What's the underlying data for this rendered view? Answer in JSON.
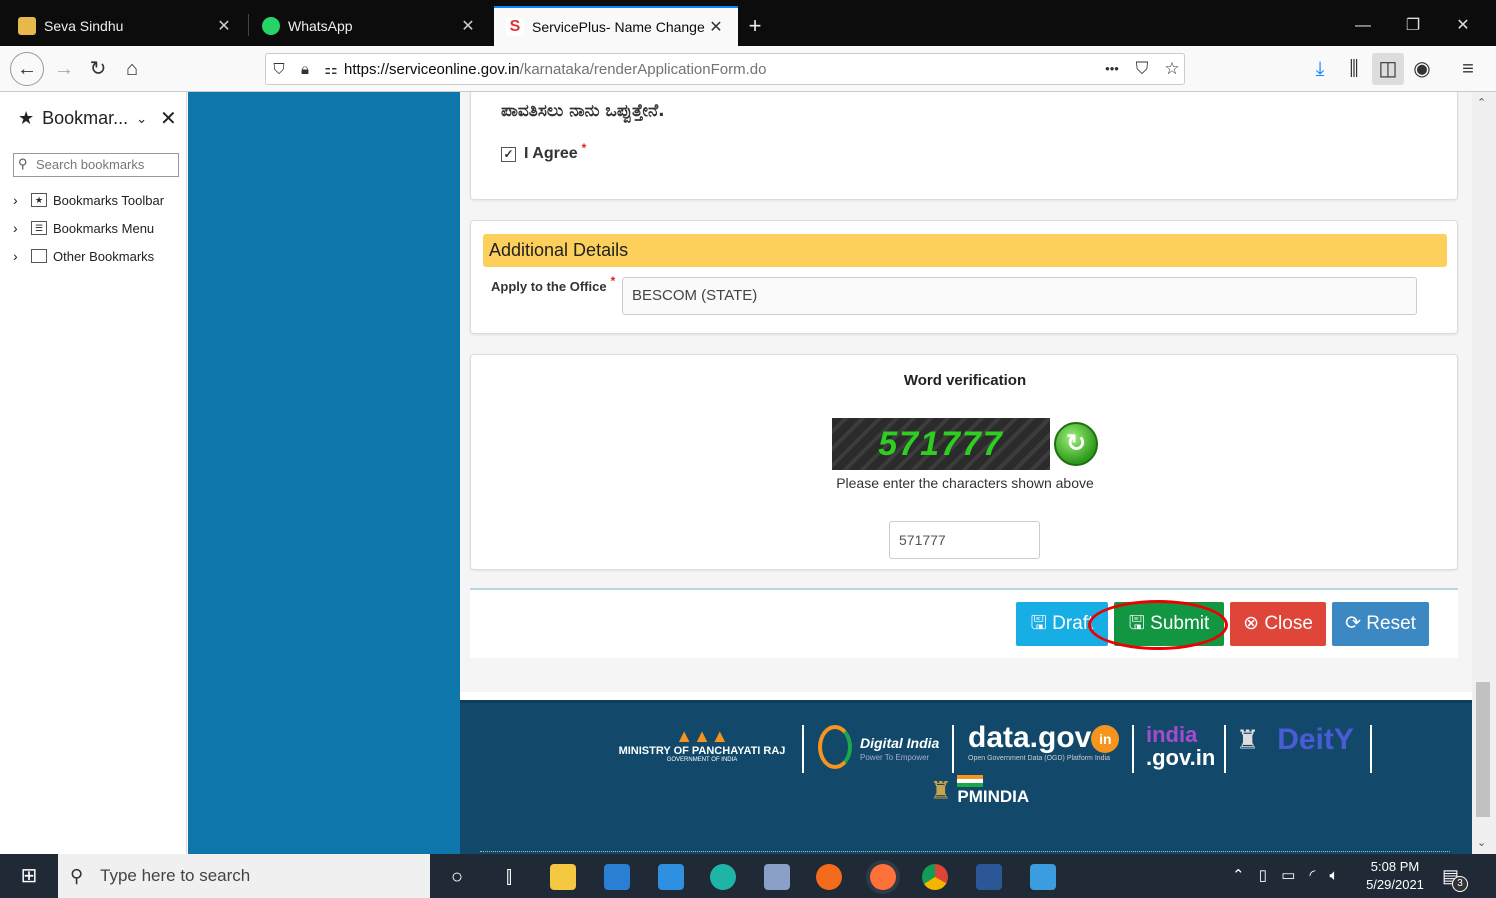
{
  "browser": {
    "tabs": [
      {
        "title": "Seva Sindhu",
        "icon": "seva-sindhu-icon"
      },
      {
        "title": "WhatsApp",
        "icon": "whatsapp-icon"
      },
      {
        "title": "ServicePlus- Name Change - N",
        "icon": "serviceplus-icon",
        "active": true
      }
    ],
    "new_tab": "+",
    "url_host": "https://serviceonline.gov.in",
    "url_path": "/karnataka/renderApplicationForm.do",
    "more": "•••"
  },
  "sidebar": {
    "title": "Bookmar...",
    "search_placeholder": "Search bookmarks",
    "items": [
      {
        "label": "Bookmarks Toolbar"
      },
      {
        "label": "Bookmarks Menu"
      },
      {
        "label": "Other Bookmarks"
      }
    ]
  },
  "form": {
    "declaration_text": "ಪಾವತಿಸಲು ನಾನು ಒಪ್ಪುತ್ತೇನೆ.",
    "agree_label": "I Agree",
    "required_mark": "*",
    "section_title": "Additional Details",
    "office_label": "Apply to the Office",
    "office_value": "BESCOM (STATE)",
    "word_verification_title": "Word verification",
    "captcha_text": "571777",
    "captcha_hint": "Please enter the characters shown above",
    "captcha_value": "571777"
  },
  "buttons": {
    "draft": "Draft",
    "submit": "Submit",
    "close": "Close",
    "reset": "Reset"
  },
  "footer": {
    "panchayati": "MINISTRY OF PANCHAYATI RAJ",
    "panchayati_sub": "GOVERNMENT OF INDIA",
    "digital_india": "Digital India",
    "digital_india_sub": "Power To Empower",
    "datagov": "data.gov",
    "datagov_sub": "Open Government Data (OGD) Platform India",
    "indiagov": ".gov.in",
    "deity": "DeitY",
    "pmindia": "PMINDIA"
  },
  "taskbar": {
    "search_placeholder": "Type here to search",
    "time": "5:08 PM",
    "date": "5/29/2021",
    "notification_count": "3"
  }
}
